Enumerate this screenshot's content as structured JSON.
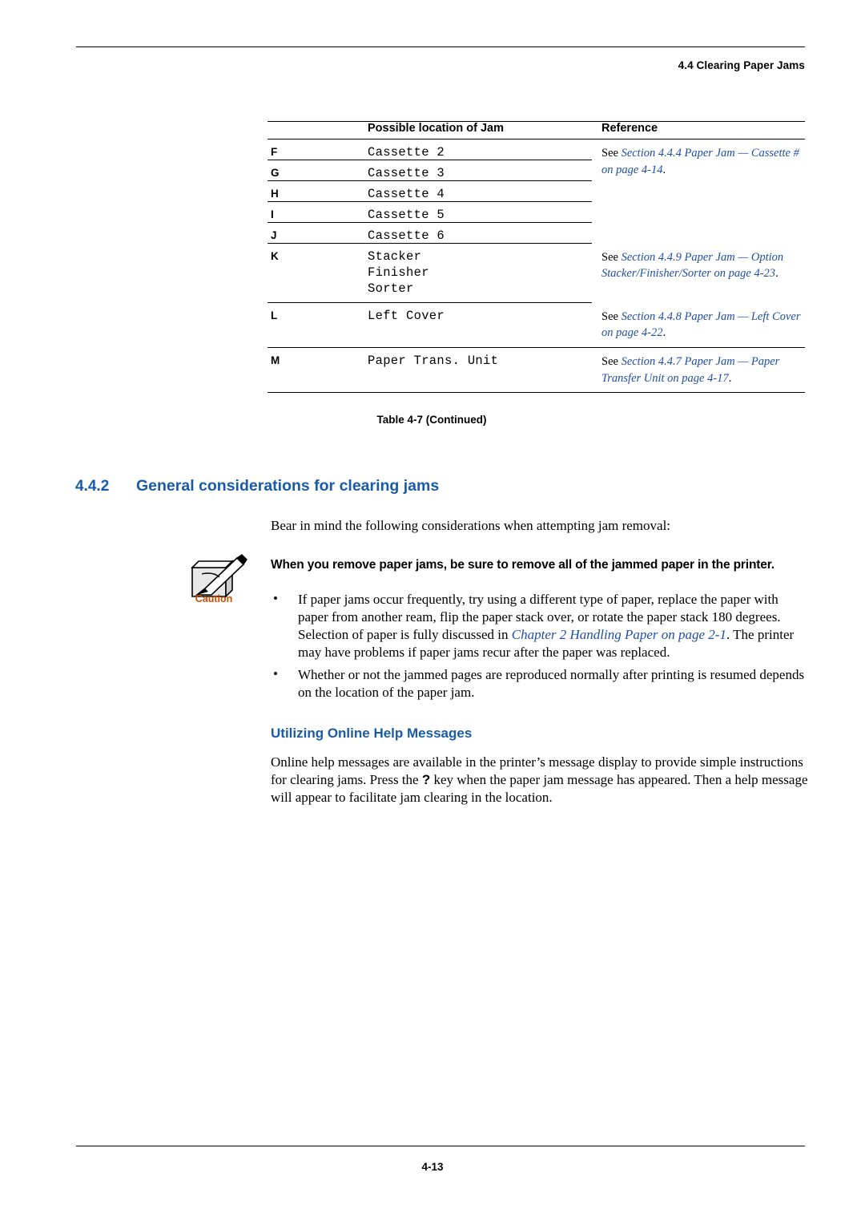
{
  "header": {
    "running_head": "4.4 Clearing Paper Jams"
  },
  "footer": {
    "page_number": "4-13"
  },
  "table": {
    "columns": [
      "",
      "Possible location of Jam",
      "Reference"
    ],
    "caption": "Table 4-7  (Continued)",
    "rows": [
      {
        "letter": "F",
        "location": "Cassette 2",
        "reference_plain": "See ",
        "reference_italic": "Section 4.4.4 Paper Jam — Cassette # on page 4-14",
        "reference_tail": "."
      },
      {
        "letter": "G",
        "location": "Cassette 3",
        "reference_plain": "",
        "reference_italic": "",
        "reference_tail": ""
      },
      {
        "letter": "H",
        "location": "Cassette 4",
        "reference_plain": "",
        "reference_italic": "",
        "reference_tail": ""
      },
      {
        "letter": "I",
        "location": "Cassette 5",
        "reference_plain": "",
        "reference_italic": "",
        "reference_tail": ""
      },
      {
        "letter": "J",
        "location": "Cassette 6",
        "reference_plain": "",
        "reference_italic": "",
        "reference_tail": ""
      },
      {
        "letter": "K",
        "location": "Stacker",
        "location_line2": "Finisher",
        "location_line3": "Sorter",
        "reference_plain": "See ",
        "reference_italic": "Section 4.4.9 Paper Jam — Option Stacker/Finisher/Sorter on page 4-23",
        "reference_tail": "."
      },
      {
        "letter": "L",
        "location": "Left Cover",
        "reference_plain": "See ",
        "reference_italic": "Section 4.4.8 Paper Jam — Left Cover on page 4-22",
        "reference_tail": "."
      },
      {
        "letter": "M",
        "location": "Paper Trans. Unit",
        "reference_plain": "See ",
        "reference_italic": "Section 4.4.7 Paper Jam — Paper Transfer Unit on page 4-17",
        "reference_tail": "."
      }
    ]
  },
  "section": {
    "number": "4.4.2",
    "title": "General considerations for clearing jams",
    "intro": "Bear in mind the following considerations when attempting jam removal:",
    "caution_heading": "When you remove paper jams, be sure to remove all of the jammed paper in the printer.",
    "caution_label": "Caution",
    "bullets": [
      {
        "part1": "If paper jams occur frequently, try using a different type of paper, replace the paper with paper from another ream, flip the paper stack over, or rotate the paper stack 180 degrees. Selection of paper is fully discussed in ",
        "link": "Chapter 2 Handling Paper on page 2-1",
        "part2": ". The printer may have problems if paper jams recur after the paper was replaced."
      },
      {
        "part1": "Whether or not the jammed pages are reproduced normally after printing is resumed depends on the location of the paper jam.",
        "link": "",
        "part2": ""
      }
    ],
    "subheading": "Utilizing Online Help Messages",
    "help_text_1": "Online help messages are available in the printer’s message display to provide simple instructions for clearing jams. Press the ",
    "help_key": "?",
    "help_text_2": " key when the paper jam message has appeared. Then a help message will appear to facilitate jam clearing in the location."
  }
}
